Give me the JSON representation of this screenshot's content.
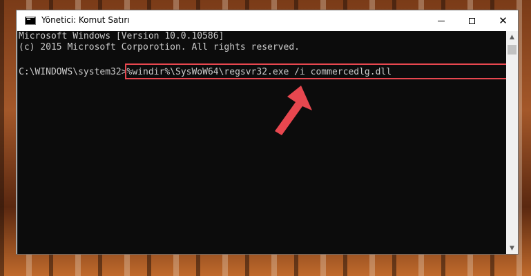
{
  "window": {
    "title": "Yönetici: Komut Satırı",
    "close_glyph": "✕",
    "scroll_up_glyph": "▲",
    "scroll_down_glyph": "▼"
  },
  "console": {
    "line1": "Microsoft Windows [Version 10.0.10586]",
    "line2": "(c) 2015 Microsoft Corporotion. All rights reserved.",
    "prompt": "C:\\WINDOWS\\system32>",
    "command": "%windir%\\SysWoW64\\regsvr32.exe /i commercedlg.dll"
  },
  "colors": {
    "highlight": "#e8474f",
    "arrow": "#e8474f",
    "console_bg": "#0c0c0c",
    "console_text": "#cccccc"
  }
}
